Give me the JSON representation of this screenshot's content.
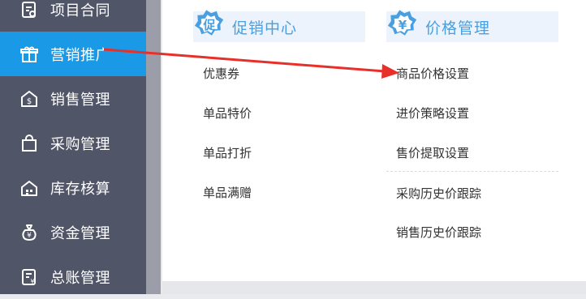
{
  "sidebar": {
    "items": [
      {
        "label": "项目合同",
        "icon": "contract-icon"
      },
      {
        "label": "营销推广",
        "icon": "gift-icon"
      },
      {
        "label": "销售管理",
        "icon": "sales-icon"
      },
      {
        "label": "采购管理",
        "icon": "shopping-bag-icon"
      },
      {
        "label": "库存核算",
        "icon": "warehouse-icon"
      },
      {
        "label": "资金管理",
        "icon": "money-bag-icon"
      },
      {
        "label": "总账管理",
        "icon": "ledger-icon"
      }
    ],
    "active_index": 1
  },
  "promo": {
    "title": "促销中心",
    "icon": "promo-badge-icon",
    "links": [
      "优惠券",
      "单品特价",
      "单品打折",
      "单品满赠"
    ]
  },
  "price": {
    "title": "价格管理",
    "icon": "yen-badge-icon",
    "links": [
      "商品价格设置",
      "进价策略设置",
      "售价提取设置",
      "采购历史价跟踪",
      "销售历史价跟踪"
    ]
  },
  "colors": {
    "sidebar_bg": "#515568",
    "active_bg": "#1a9ae6",
    "accent": "#4a9fe0",
    "arrow": "#e8302a"
  }
}
